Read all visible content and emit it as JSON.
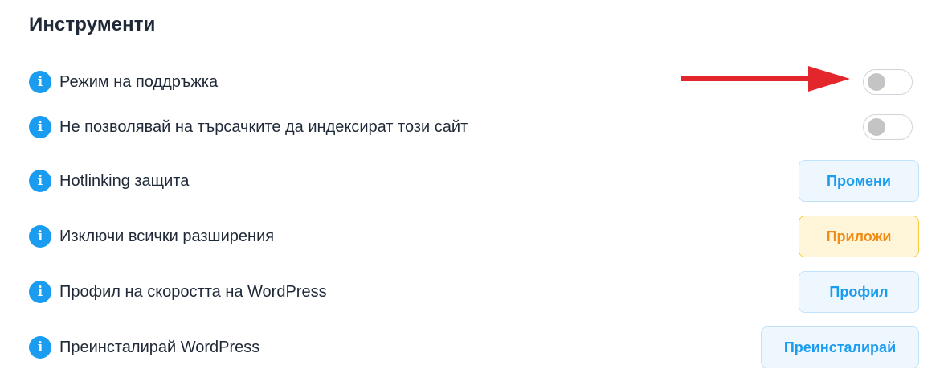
{
  "section": {
    "title": "Инструменти"
  },
  "rows": [
    {
      "label": "Режим на поддръжка",
      "control": "toggle",
      "enabled": false
    },
    {
      "label": "Не позволявай на търсачките да индексират този сайт",
      "control": "toggle",
      "enabled": false
    },
    {
      "label": "Hotlinking защита",
      "control": "button",
      "button_label": "Промени"
    },
    {
      "label": "Изключи всички разширения",
      "control": "button",
      "button_label": "Приложи"
    },
    {
      "label": "Профил на скоростта на WordPress",
      "control": "button",
      "button_label": "Профил"
    },
    {
      "label": "Преинсталирай WordPress",
      "control": "button",
      "button_label": "Преинсталирай"
    }
  ],
  "icons": {
    "info": "info-icon",
    "info_glyph": "i"
  },
  "colors": {
    "accent_blue": "#1a9cf0",
    "warning_orange": "#f28c16",
    "annotation_red": "#e3262b"
  }
}
